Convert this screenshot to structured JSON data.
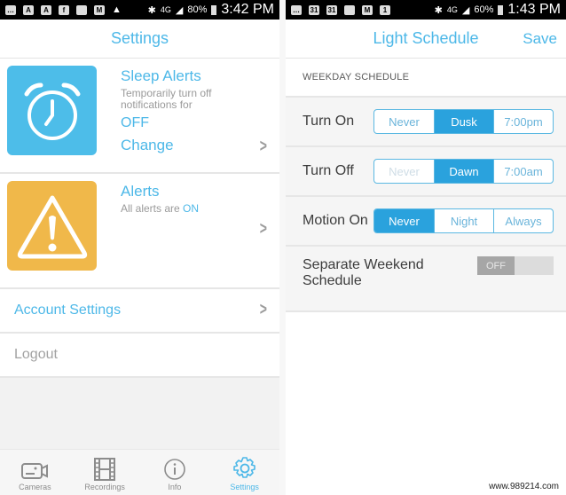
{
  "left": {
    "status_bar": {
      "icons": [
        "message-icon",
        "app-a-icon",
        "app-a-icon",
        "facebook-icon",
        "image-icon",
        "email-icon",
        "warning-icon"
      ],
      "network": "4G",
      "battery": "80%",
      "time": "3:42 PM"
    },
    "header": {
      "title": "Settings"
    },
    "sleep_alerts": {
      "title": "Sleep Alerts",
      "description": "Temporarily turn off notifications for",
      "value": "OFF",
      "action": "Change"
    },
    "alerts": {
      "title": "Alerts",
      "description": "All alerts are",
      "status": "ON"
    },
    "account_settings": "Account Settings",
    "logout": "Logout",
    "tabs": [
      {
        "label": "Cameras",
        "icon": "camera-icon",
        "active": false
      },
      {
        "label": "Recordings",
        "icon": "film-icon",
        "active": false
      },
      {
        "label": "Info",
        "icon": "info-icon",
        "active": false
      },
      {
        "label": "Settings",
        "icon": "gear-icon",
        "active": true
      }
    ]
  },
  "right": {
    "status_bar": {
      "icons": [
        "message-icon",
        "calendar-icon",
        "calendar-icon",
        "app-icon",
        "email-icon",
        "calendar-icon"
      ],
      "network": "4G",
      "battery": "60%",
      "time": "1:43 PM"
    },
    "header": {
      "title": "Light Schedule",
      "save": "Save"
    },
    "section_title": "WEEKDAY SCHEDULE",
    "rows": [
      {
        "label": "Turn On",
        "options": [
          "Never",
          "Dusk",
          "7:00pm"
        ],
        "selected": 1,
        "disabled": []
      },
      {
        "label": "Turn Off",
        "options": [
          "Never",
          "Dawn",
          "7:00am"
        ],
        "selected": 1,
        "disabled": [
          0
        ]
      },
      {
        "label": "Motion On",
        "options": [
          "Never",
          "Night",
          "Always"
        ],
        "selected": 0,
        "disabled": []
      }
    ],
    "weekend": {
      "label": "Separate Weekend Schedule",
      "toggle": "OFF"
    }
  },
  "watermark": "www.989214.com",
  "colors": {
    "accent": "#4db8e8",
    "selected": "#2aa2dd",
    "sleep_tile": "#4dbde9",
    "alert_tile": "#f0b84a"
  }
}
